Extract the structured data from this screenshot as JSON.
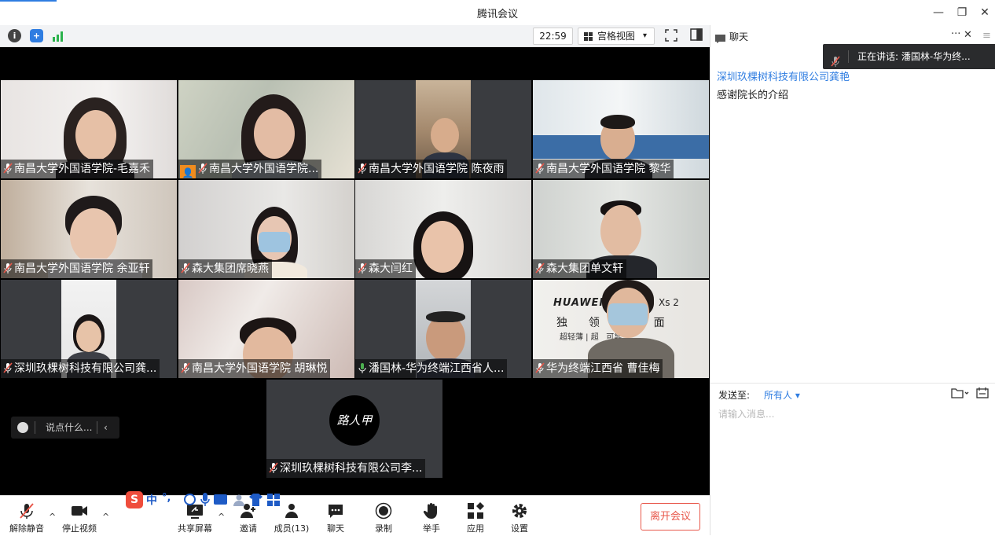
{
  "window": {
    "title": "腾讯会议",
    "minimize": "—",
    "restore": "❐",
    "close": "✕"
  },
  "meeting_bar": {
    "timer": "22:59",
    "view_label": "宫格视图",
    "view_caret": "▾"
  },
  "tiles": [
    {
      "name": "南昌大学外国语学院-毛嘉禾",
      "muted": true,
      "host": false
    },
    {
      "name": "南昌大学外国语学院...",
      "muted": true,
      "host": true
    },
    {
      "name": "南昌大学外国语学院 陈夜雨",
      "muted": true,
      "host": false
    },
    {
      "name": "南昌大学外国语学院  黎华",
      "muted": true,
      "host": false
    },
    {
      "name": "南昌大学外国语学院 余亚轩",
      "muted": true,
      "host": false
    },
    {
      "name": "森大集团席晓燕",
      "muted": true,
      "host": false
    },
    {
      "name": "森大闫红",
      "muted": true,
      "host": false
    },
    {
      "name": "森大集团单文轩",
      "muted": true,
      "host": false
    },
    {
      "name": "深圳玖棵树科技有限公司龚...",
      "muted": true,
      "host": false
    },
    {
      "name": "南昌大学外国语学院 胡琳悦",
      "muted": true,
      "host": false
    },
    {
      "name": "潘国林-华为终端江西省人...",
      "muted": false,
      "host": false
    },
    {
      "name": "华为终端江西省  曹佳梅",
      "muted": true,
      "host": false
    },
    {
      "name": "深圳玖棵树科技有限公司李...",
      "muted": true,
      "host": false
    }
  ],
  "avatar_text": "路人甲",
  "poster": {
    "line1": "HUAWEI",
    "line2": "Xs 2",
    "line3": "独  领      面",
    "line4": "超轻薄 | 超   可靠"
  },
  "say_bar": {
    "placeholder": "说点什么...",
    "collapse": "‹"
  },
  "toolbar": {
    "mute": "解除静音",
    "video": "停止视频",
    "share": "共享屏幕",
    "invite": "邀请",
    "members": "成员(13)",
    "chat": "聊天",
    "record": "录制",
    "raise": "举手",
    "apps": "应用",
    "settings": "设置",
    "leave": "离开会议",
    "caret": "^"
  },
  "chat": {
    "title": "聊天",
    "more": "···",
    "close": "✕",
    "speaking": "正在讲话: 潘国林-华为终...",
    "sender": "深圳玖棵树科技有限公司龚艳",
    "message": "感谢院长的介绍",
    "send_to_label": "发送至:",
    "send_to_value": "所有人 ▾",
    "input_placeholder": "请输入消息..."
  },
  "ime": {
    "lang": "中",
    "punct": "°,"
  },
  "colors": {
    "accent": "#2f7de1",
    "leave": "#e8574a",
    "host": "#f08c1e",
    "mic_off": "#e8574a",
    "mic_on": "#4caf50"
  }
}
